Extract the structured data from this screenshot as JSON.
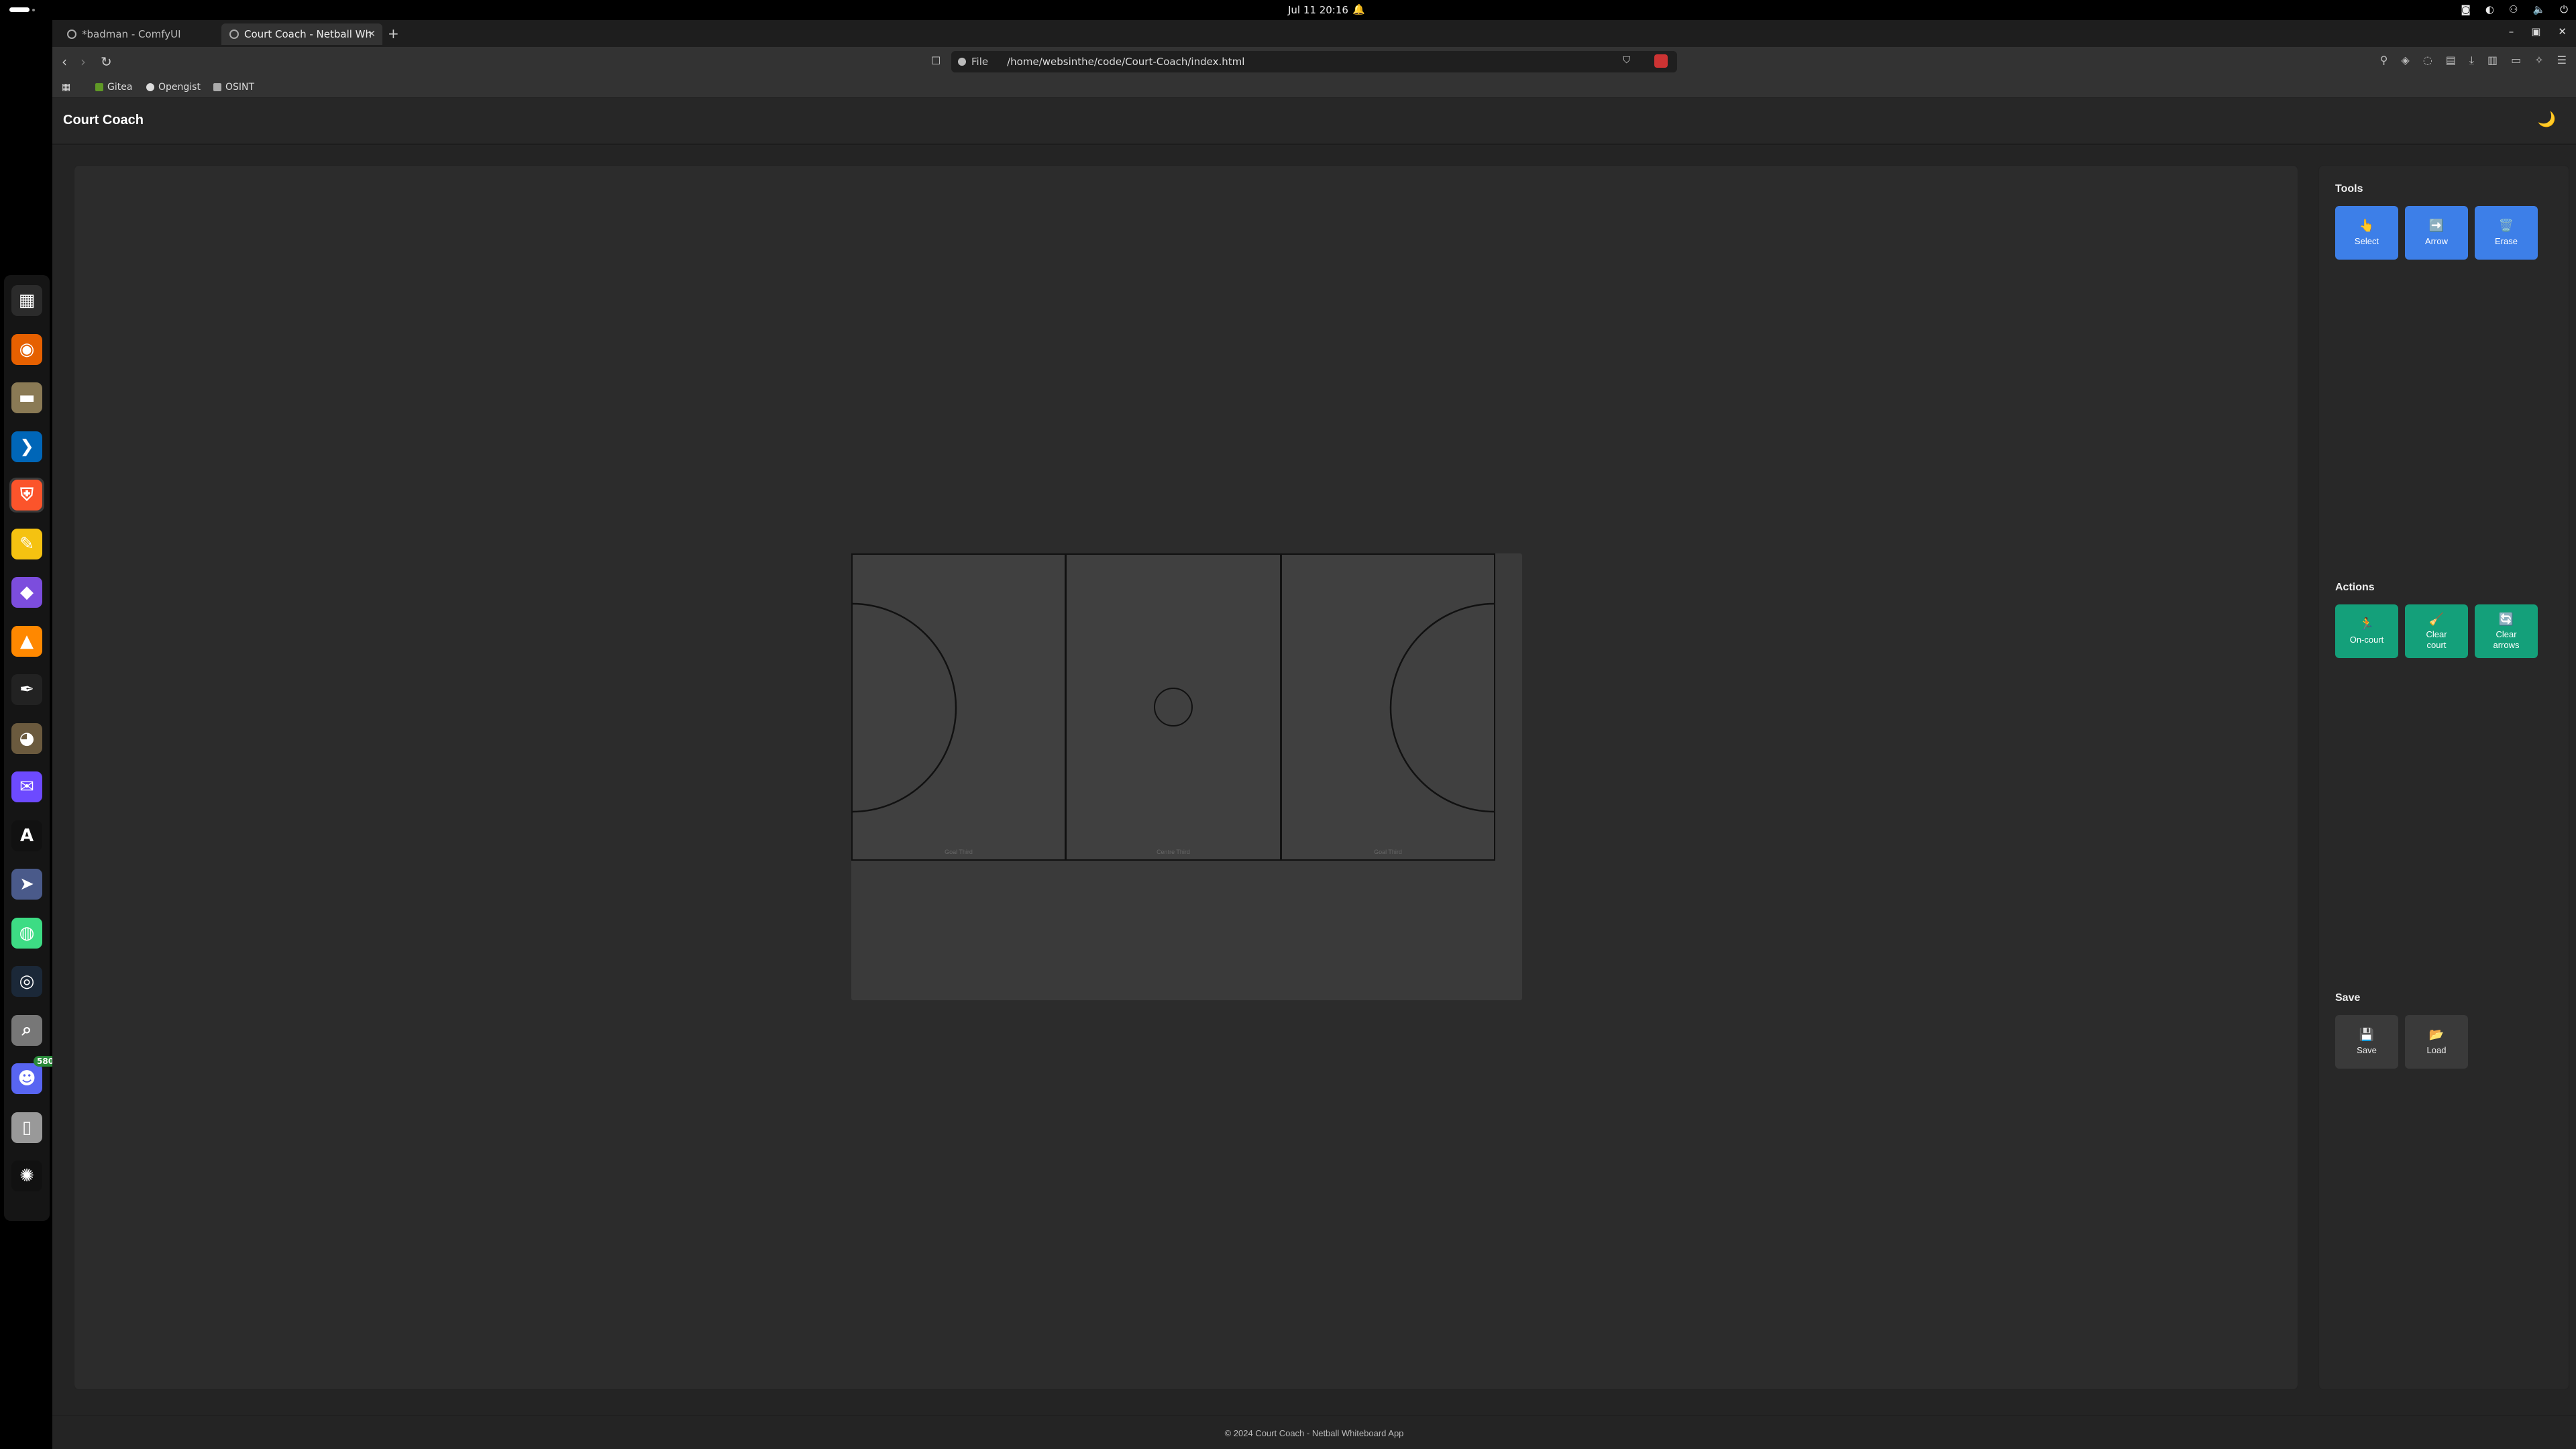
{
  "topbar": {
    "clock": "Jul 11  20:16",
    "bell_icon": "bell-icon",
    "tray_icons": [
      "discord-icon",
      "sync-icon",
      "network-icon",
      "volume-icon",
      "power-icon"
    ]
  },
  "dock": {
    "apps": [
      {
        "name": "workspace-switcher-icon",
        "glyph": "▦",
        "color": "#2b2b2b"
      },
      {
        "name": "firefox-icon",
        "glyph": "◉",
        "color": "#e66000"
      },
      {
        "name": "files-icon",
        "glyph": "▬",
        "color": "#8a7a55"
      },
      {
        "name": "vscode-icon",
        "glyph": "❯",
        "color": "#0066b8"
      },
      {
        "name": "brave-icon",
        "glyph": "⛨",
        "color": "#fb542b"
      },
      {
        "name": "text-editor-icon",
        "glyph": "✎",
        "color": "#f5c211"
      },
      {
        "name": "obsidian-icon",
        "glyph": "◆",
        "color": "#7c4ddd"
      },
      {
        "name": "vlc-icon",
        "glyph": "▲",
        "color": "#ff8800"
      },
      {
        "name": "inkscape-icon",
        "glyph": "✒",
        "color": "#222"
      },
      {
        "name": "gimp-icon",
        "glyph": "◕",
        "color": "#6b5a3e"
      },
      {
        "name": "proton-mail-icon",
        "glyph": "✉",
        "color": "#6d4aff"
      },
      {
        "name": "anytype-icon",
        "glyph": "A",
        "color": "#111"
      },
      {
        "name": "terminal-forward-icon",
        "glyph": "➤",
        "color": "#4a5a8a"
      },
      {
        "name": "android-studio-icon",
        "glyph": "◍",
        "color": "#3ddc84"
      },
      {
        "name": "steam-icon",
        "glyph": "◎",
        "color": "#1b2838"
      },
      {
        "name": "search-tool-icon",
        "glyph": "⌕",
        "color": "#777"
      },
      {
        "name": "discord-icon",
        "glyph": "☻",
        "color": "#5865f2",
        "badge": "580"
      },
      {
        "name": "blank-app-icon",
        "glyph": "▯",
        "color": "#999"
      },
      {
        "name": "ubuntu-apps-icon",
        "glyph": "✺",
        "color": "#111"
      }
    ]
  },
  "browser": {
    "tabs": [
      {
        "title": "*badman - ComfyUI",
        "active": false
      },
      {
        "title": "Court Coach - Netball Wh",
        "active": true
      }
    ],
    "new_tab": "+",
    "window_controls": [
      "–",
      "▣",
      "✕"
    ],
    "url_scheme": "File",
    "url": "/home/websinthe/code/Court-Coach/index.html",
    "bookmarks": [
      {
        "label": "Gitea",
        "icon": "gitea-icon",
        "color": "#609926"
      },
      {
        "label": "Opengist",
        "icon": "github-icon",
        "color": "#ddd"
      },
      {
        "label": "OSINT",
        "icon": "folder-icon",
        "color": "#aaa"
      }
    ]
  },
  "app": {
    "title": "Court Coach",
    "theme_toggle": "🌙",
    "court": {
      "thirds": [
        "Goal Third",
        "Centre Third",
        "Goal Third"
      ]
    },
    "sidebar": {
      "tools": {
        "title": "Tools",
        "buttons": [
          {
            "emoji": "👆",
            "label": "Select"
          },
          {
            "emoji": "➡️",
            "label": "Arrow"
          },
          {
            "emoji": "🗑️",
            "label": "Erase"
          }
        ]
      },
      "actions": {
        "title": "Actions",
        "buttons": [
          {
            "emoji": "🏃",
            "label": "On-court"
          },
          {
            "emoji": "🧹",
            "label": "Clear court"
          },
          {
            "emoji": "🔄",
            "label": "Clear arrows"
          }
        ]
      },
      "save": {
        "title": "Save",
        "buttons": [
          {
            "emoji": "💾",
            "label": "Save"
          },
          {
            "emoji": "📂",
            "label": "Load"
          }
        ]
      }
    },
    "footer": "© 2024 Court Coach - Netball Whiteboard App"
  }
}
